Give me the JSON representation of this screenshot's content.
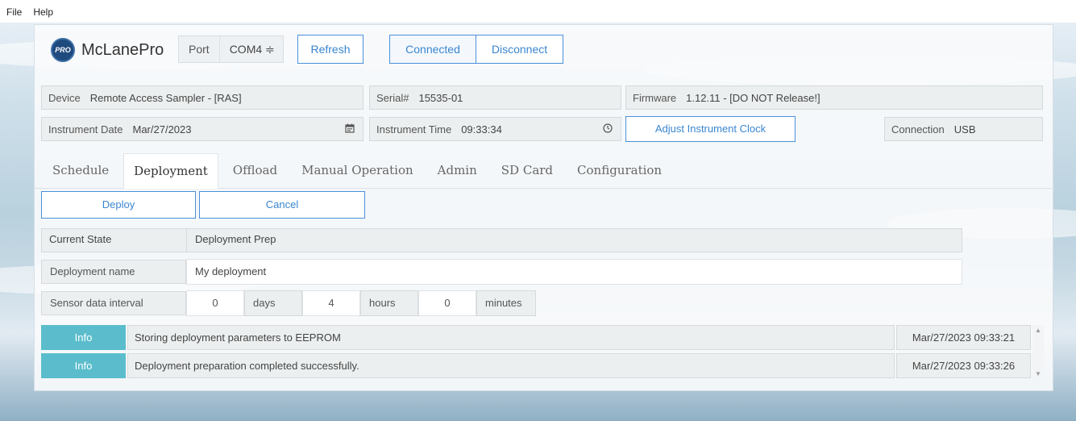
{
  "menu": {
    "file": "File",
    "help": "Help"
  },
  "header": {
    "logo_badge": "PRO",
    "app_name": "McLanePro",
    "port_label": "Port",
    "port_value": "COM4 ≑",
    "refresh": "Refresh",
    "connected": "Connected",
    "disconnect": "Disconnect"
  },
  "info": {
    "device_label": "Device",
    "device_value": "Remote Access Sampler - [RAS]",
    "serial_label": "Serial#",
    "serial_value": "15535-01",
    "firmware_label": "Firmware",
    "firmware_value": "1.12.11 - [DO NOT Release!]",
    "date_label": "Instrument Date",
    "date_value": "Mar/27/2023",
    "time_label": "Instrument Time",
    "time_value": "09:33:34",
    "adjust_clock": "Adjust Instrument Clock",
    "connection_label": "Connection",
    "connection_value": "USB"
  },
  "tabs": [
    "Schedule",
    "Deployment",
    "Offload",
    "Manual Operation",
    "Admin",
    "SD Card",
    "Configuration"
  ],
  "active_tab": "Deployment",
  "actions": {
    "deploy": "Deploy",
    "cancel": "Cancel"
  },
  "form": {
    "state_label": "Current State",
    "state_value": "Deployment Prep",
    "name_label": "Deployment name",
    "name_value": "My deployment",
    "interval_label": "Sensor data interval",
    "days_value": "0",
    "days_unit": "days",
    "hours_value": "4",
    "hours_unit": "hours",
    "minutes_value": "0",
    "minutes_unit": "minutes"
  },
  "log": [
    {
      "level": "Info",
      "message": "Storing deployment parameters to EEPROM",
      "timestamp": "Mar/27/2023 09:33:21"
    },
    {
      "level": "Info",
      "message": "Deployment preparation completed successfully.",
      "timestamp": "Mar/27/2023 09:33:26"
    }
  ],
  "icons": {
    "calendar": "calendar-icon",
    "clock": "clock-icon"
  }
}
